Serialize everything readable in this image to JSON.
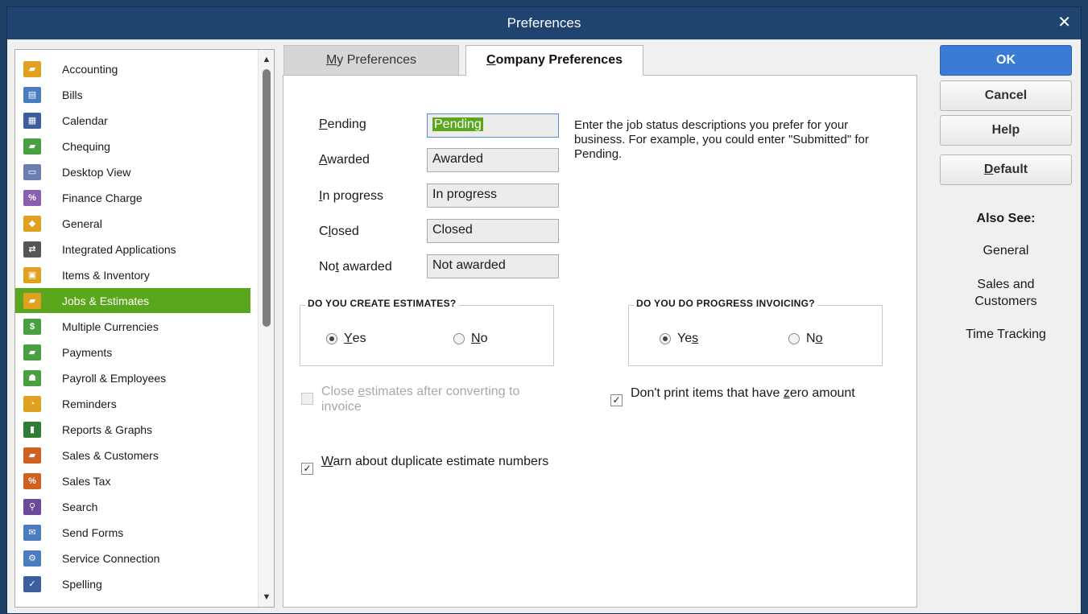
{
  "window": {
    "title": "Preferences"
  },
  "categories": [
    {
      "label": "Accounting",
      "icon": "accounting-icon",
      "color": "#e0a020"
    },
    {
      "label": "Bills",
      "icon": "bills-icon",
      "color": "#4a7cc0"
    },
    {
      "label": "Calendar",
      "icon": "calendar-icon",
      "color": "#3a5f9c"
    },
    {
      "label": "Chequing",
      "icon": "chequing-icon",
      "color": "#4aa040"
    },
    {
      "label": "Desktop View",
      "icon": "desktop-view-icon",
      "color": "#6a7fb0"
    },
    {
      "label": "Finance Charge",
      "icon": "finance-charge-icon",
      "color": "#8a5fb0"
    },
    {
      "label": "General",
      "icon": "general-icon",
      "color": "#e0a020"
    },
    {
      "label": "Integrated Applications",
      "icon": "integrated-apps-icon",
      "color": "#555555"
    },
    {
      "label": "Items & Inventory",
      "icon": "items-inventory-icon",
      "color": "#e0a020"
    },
    {
      "label": "Jobs & Estimates",
      "icon": "jobs-estimates-icon",
      "color": "#e0a020"
    },
    {
      "label": "Multiple Currencies",
      "icon": "multiple-currencies-icon",
      "color": "#4aa040"
    },
    {
      "label": "Payments",
      "icon": "payments-icon",
      "color": "#4aa040"
    },
    {
      "label": "Payroll & Employees",
      "icon": "payroll-employees-icon",
      "color": "#4aa040"
    },
    {
      "label": "Reminders",
      "icon": "reminders-icon",
      "color": "#e0a020"
    },
    {
      "label": "Reports & Graphs",
      "icon": "reports-graphs-icon",
      "color": "#2e7d32"
    },
    {
      "label": "Sales & Customers",
      "icon": "sales-customers-icon",
      "color": "#d06020"
    },
    {
      "label": "Sales Tax",
      "icon": "sales-tax-icon",
      "color": "#d06020"
    },
    {
      "label": "Search",
      "icon": "search-icon",
      "color": "#6a4a9a"
    },
    {
      "label": "Send Forms",
      "icon": "send-forms-icon",
      "color": "#4a7cc0"
    },
    {
      "label": "Service Connection",
      "icon": "service-connection-icon",
      "color": "#4a7cc0"
    },
    {
      "label": "Spelling",
      "icon": "spelling-icon",
      "color": "#3a5f9c"
    }
  ],
  "selected_category": "Jobs & Estimates",
  "tabs": {
    "my_prefs_prefix": "M",
    "my_prefs_rest": "y Preferences",
    "company_prefs_prefix": "C",
    "company_prefs_rest": "ompany Preferences"
  },
  "status_fields": {
    "pending_label_prefix": "P",
    "pending_label_rest": "ending",
    "pending_value": "Pending",
    "awarded_label_prefix": "A",
    "awarded_label_rest": "warded",
    "awarded_value": "Awarded",
    "in_progress_label_prefix": "I",
    "in_progress_label_rest": "n progress",
    "in_progress_value": "In progress",
    "closed_label_start": "C",
    "closed_label_ul": "l",
    "closed_label_end": "osed",
    "closed_value": "Closed",
    "not_awarded_label_start": "No",
    "not_awarded_label_ul": "t",
    "not_awarded_label_end": " awarded",
    "not_awarded_value": "Not awarded"
  },
  "help_text": "Enter the job status descriptions you prefer for your business.  For example, you could enter \"Submitted\" for Pending.",
  "estimates_group": {
    "title": "DO YOU CREATE ESTIMATES?",
    "yes_ul": "Y",
    "yes_rest": "es",
    "no_ul": "N",
    "no_rest": "o",
    "selected": "Yes"
  },
  "progress_group": {
    "title": "DO YOU DO PROGRESS INVOICING?",
    "yes_start": "Ye",
    "yes_ul": "s",
    "no_start": "N",
    "no_ul": "o",
    "selected": "Yes"
  },
  "checkboxes": {
    "close_estimates_start": "Close ",
    "close_estimates_ul": "e",
    "close_estimates_end": "stimates after converting to invoice",
    "close_estimates_checked": false,
    "close_estimates_enabled": false,
    "zero_amount_start": "Don't print items that have ",
    "zero_amount_ul": "z",
    "zero_amount_end": "ero amount",
    "zero_amount_checked": true,
    "warn_duplicate_ul": "W",
    "warn_duplicate_rest": "arn about duplicate estimate numbers",
    "warn_duplicate_checked": true
  },
  "buttons": {
    "ok": "OK",
    "cancel": "Cancel",
    "help": "Help",
    "default_ul": "D",
    "default_rest": "efault"
  },
  "also_see": {
    "title": "Also See:",
    "links": [
      "General",
      "Sales and Customers",
      "Time Tracking"
    ]
  },
  "colors": {
    "titlebar": "#1f4470",
    "selection": "#5aa61d",
    "primary_button": "#3a7bd5"
  }
}
